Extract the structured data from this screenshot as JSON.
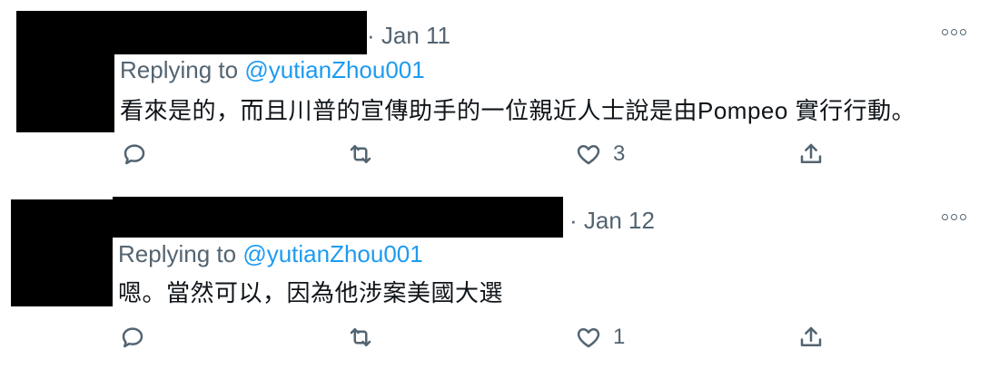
{
  "tweets": [
    {
      "date": "· Jan 11",
      "replying_prefix": "Replying to",
      "replying_handle": "@yutianZhou001",
      "text": "看來是的，而且川普的宣傳助手的一位親近人士說是由Pompeo 實行行動。",
      "like_count": "3",
      "icons": [
        "reply-icon",
        "retweet-icon",
        "like-icon",
        "share-icon",
        "more-icon"
      ]
    },
    {
      "date": "· Jan 12",
      "replying_prefix": "Replying to",
      "replying_handle": "@yutianZhou001",
      "text": "嗯。當然可以，因為他涉案美國大選",
      "like_count": "1",
      "icons": [
        "reply-icon",
        "retweet-icon",
        "like-icon",
        "share-icon",
        "more-icon"
      ]
    }
  ],
  "colors": {
    "secondary_text": "#536471",
    "link": "#1d9bf0",
    "body_text": "#0f1419",
    "redaction": "#000000"
  }
}
